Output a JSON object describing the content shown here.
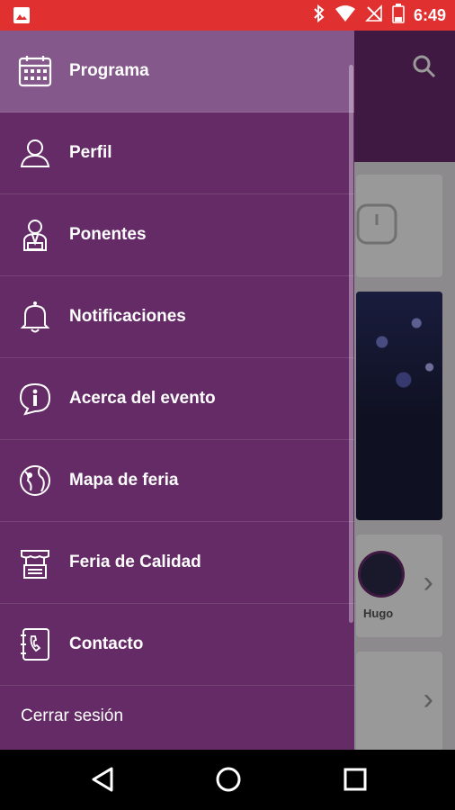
{
  "status_bar": {
    "time": "6:49"
  },
  "drawer": {
    "items": [
      {
        "label": "Programa",
        "icon": "calendar-icon"
      },
      {
        "label": "Perfil",
        "icon": "user-icon"
      },
      {
        "label": "Ponentes",
        "icon": "speaker-icon"
      },
      {
        "label": "Notificaciones",
        "icon": "bell-icon"
      },
      {
        "label": "Acerca del evento",
        "icon": "info-icon"
      },
      {
        "label": "Mapa de feria",
        "icon": "map-icon"
      },
      {
        "label": "Feria de Calidad",
        "icon": "booth-icon"
      },
      {
        "label": "Contacto",
        "icon": "contact-book-icon"
      }
    ],
    "logout_label": "Cerrar sesión"
  },
  "background": {
    "card_name": "Hugo"
  },
  "colors": {
    "drawer": "#652b66",
    "active_item": "#84588a",
    "status_bar": "#e0302f"
  }
}
